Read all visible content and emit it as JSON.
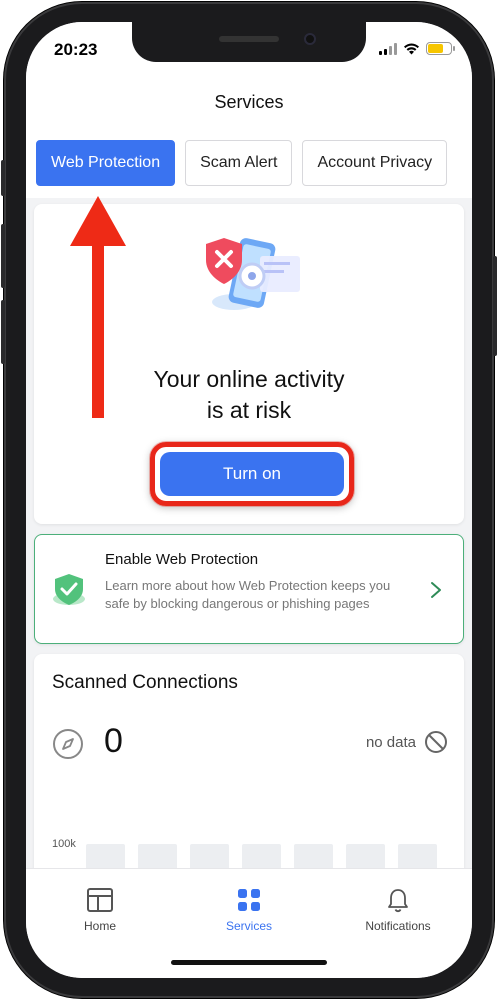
{
  "status_bar": {
    "time": "20:23"
  },
  "header": {
    "title": "Services"
  },
  "tabs": [
    {
      "label": "Web Protection",
      "active": true
    },
    {
      "label": "Scam Alert",
      "active": false
    },
    {
      "label": "Account Privacy",
      "active": false
    }
  ],
  "risk_card": {
    "line1": "Your online activity",
    "line2": "is at risk",
    "button_label": "Turn on"
  },
  "enable_card": {
    "title": "Enable Web Protection",
    "description": "Learn more about how Web Protection keeps you safe by blocking dangerous or phishing pages"
  },
  "scanned": {
    "title": "Scanned Connections",
    "count": "0",
    "status": "no data",
    "axis_label": "100k"
  },
  "bottom_nav": [
    {
      "label": "Home",
      "icon": "home-icon",
      "active": false
    },
    {
      "label": "Services",
      "icon": "services-icon",
      "active": true
    },
    {
      "label": "Notifications",
      "icon": "bell-icon",
      "active": false
    }
  ],
  "colors": {
    "accent": "#3a73f0",
    "annotation_red": "#e8271a",
    "success_green": "#4caf7a"
  }
}
